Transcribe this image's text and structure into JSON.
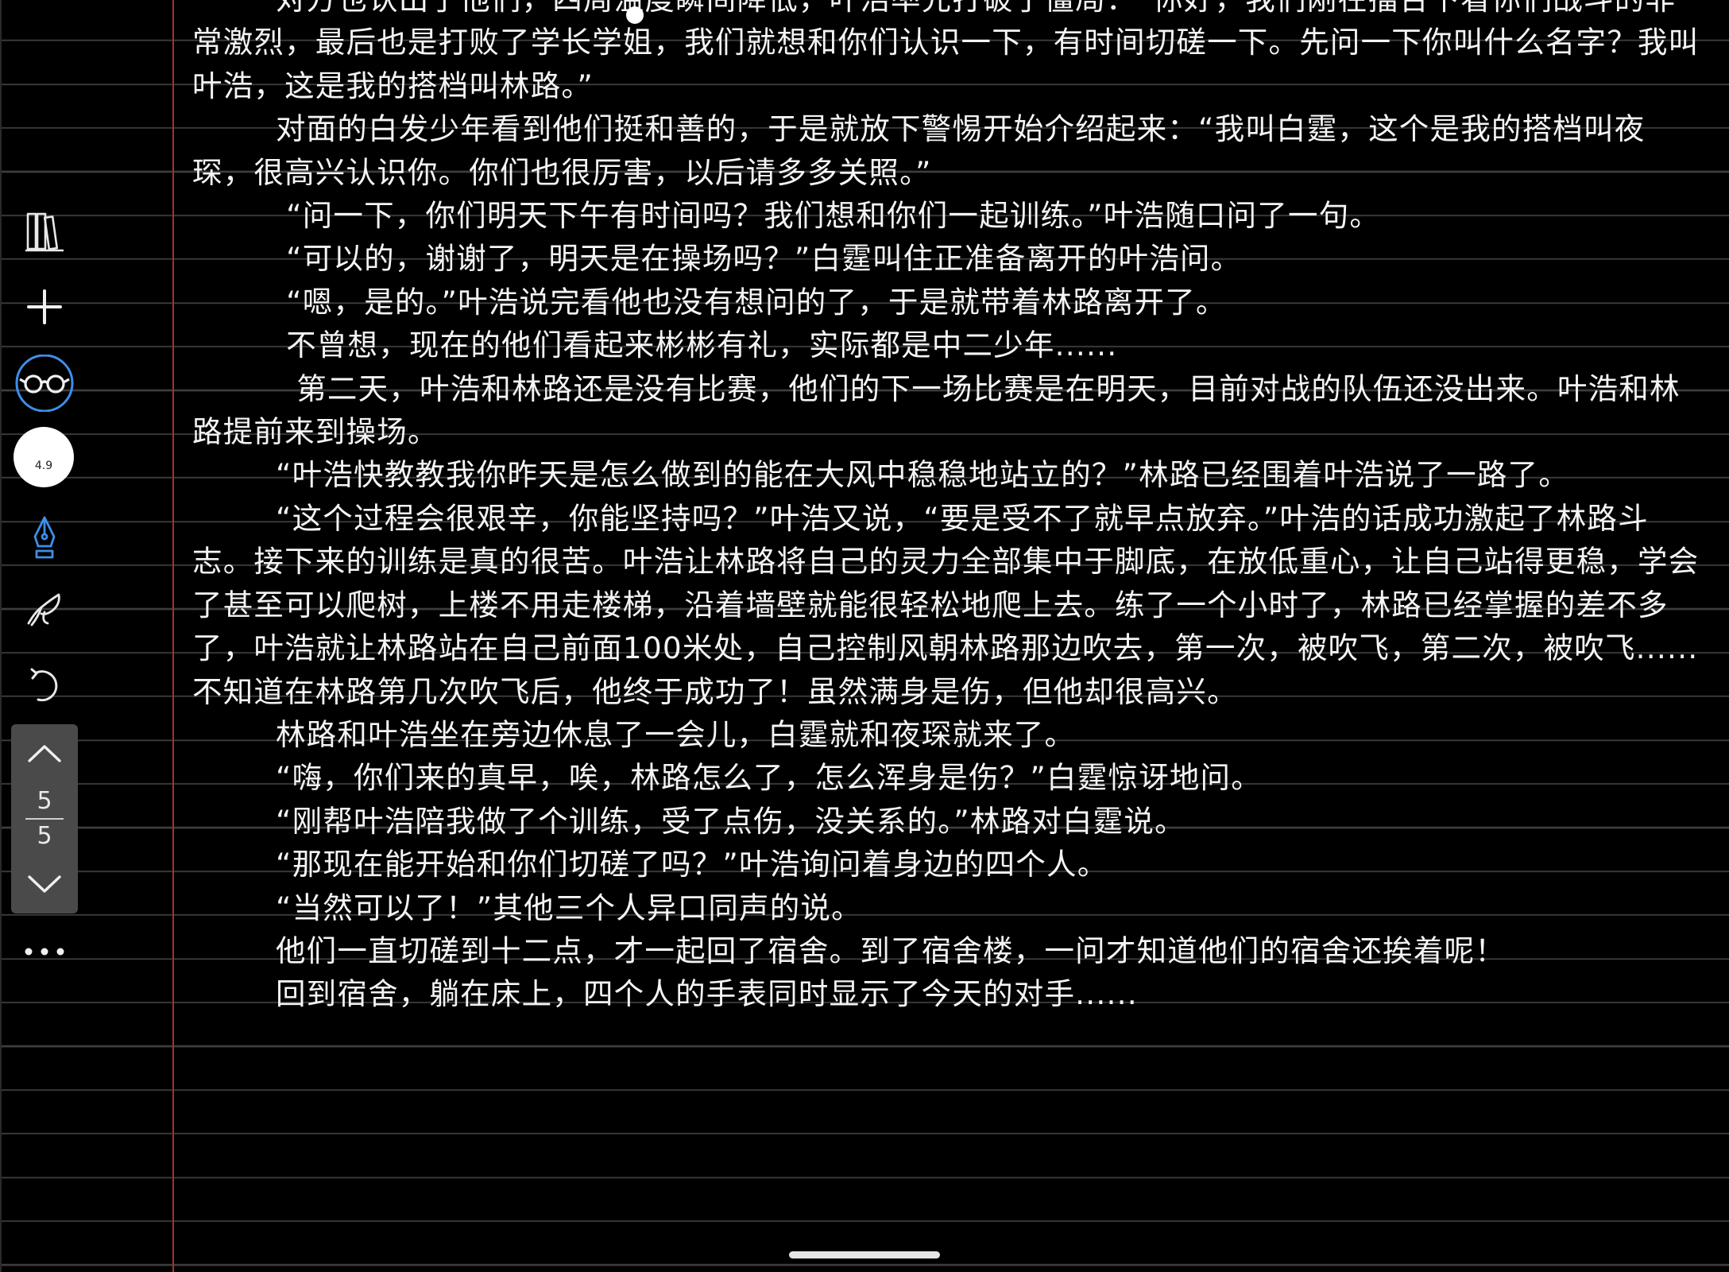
{
  "note": {
    "paragraphs": [
      "        对方也认出了他们，四周温度瞬间降低，叶浩率先打破了僵局：“你好，我们刚在擂台下看你们战斗的非常激烈，最后也是打败了学长学姐，我们就想和你们认识一下，有时间切磋一下。先问一下你叫什么名字？我叫叶浩，这是我的搭档叫林路。”",
      "        对面的白发少年看到他们挺和善的，于是就放下警惕开始介绍起来：“我叫白霆，这个是我的搭档叫夜琛，很高兴认识你。你们也很厉害，以后请多多关照。”",
      "         “问一下，你们明天下午有时间吗？我们想和你们一起训练。”叶浩随口问了一句。",
      "         “可以的，谢谢了，明天是在操场吗？”白霆叫住正准备离开的叶浩问。",
      "         “嗯，是的。”叶浩说完看他也没有想问的了，于是就带着林路离开了。",
      "         不曾想，现在的他们看起来彬彬有礼，实际都是中二少年......",
      "          第二天，叶浩和林路还是没有比赛，他们的下一场比赛是在明天，目前对战的队伍还没出来。叶浩和林路提前来到操场。",
      "        “叶浩快教教我你昨天是怎么做到的能在大风中稳稳地站立的？”林路已经围着叶浩说了一路了。",
      "        “这个过程会很艰辛，你能坚持吗？”叶浩又说，“要是受不了就早点放弃。”叶浩的话成功激起了林路斗志。接下来的训练是真的很苦。叶浩让林路将自己的灵力全部集中于脚底，在放低重心，让自己站得更稳，学会了甚至可以爬树，上楼不用走楼梯，沿着墙壁就能很轻松地爬上去。练了一个小时了，林路已经掌握的差不多了，叶浩就让林路站在自己前面100米处，自己控制风朝林路那边吹去，第一次，被吹飞，第二次，被吹飞......不知道在林路第几次吹飞后，他终于成功了！虽然满身是伤，但他却很高兴。",
      "        林路和叶浩坐在旁边休息了一会儿，白霆就和夜琛就来了。",
      "        “嗨，你们来的真早，唉，林路怎么了，怎么浑身是伤？”白霆惊讶地问。",
      "        “刚帮叶浩陪我做了个训练，受了点伤，没关系的。”林路对白霆说。",
      "        “那现在能开始和你们切磋了吗？”叶浩询问着身边的四个人。",
      "        “当然可以了！”其他三个人异口同声的说。",
      "        他们一直切磋到十二点，才一起回了宿舍。到了宿舍楼，一问才知道他们的宿舍还挨着呢！",
      "        回到宿舍，躺在床上，四个人的手表同时显示了今天的对手......"
    ]
  },
  "sidebar": {
    "tools": [
      {
        "name": "library-icon"
      },
      {
        "name": "add-icon"
      },
      {
        "name": "read-mode-icon"
      },
      {
        "name": "pen-color-icon"
      },
      {
        "name": "fountain-pen-icon"
      },
      {
        "name": "lasso-icon"
      },
      {
        "name": "undo-icon"
      },
      {
        "name": "more-icon"
      }
    ],
    "color_size": "4.9",
    "pen_color": "#3f8ee8",
    "pager": {
      "current": "5",
      "total": "5"
    }
  },
  "colors": {
    "background": "#000000",
    "rule_line": "#3d3d3d",
    "margin_line": "#a8302d",
    "text": "#f4f4f4"
  }
}
